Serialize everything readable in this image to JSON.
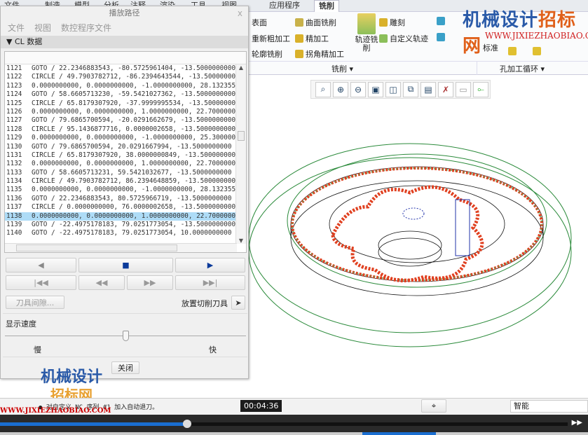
{
  "ribbon": {
    "tabs": [
      "文件",
      "制造",
      "模型",
      "分析",
      "注释",
      "渲染",
      "工具",
      "视图",
      "应用程序",
      "铣削"
    ],
    "active_tab": "铣削",
    "items": {
      "surface": "表面",
      "rerough": "重新粗加工",
      "profile": "轮廓铣削",
      "surface_mill": "曲面铣削",
      "finish": "精加工",
      "corner_finish": "拐角精加工",
      "trajectory": "轨迹铣削",
      "engrave": "雕刻",
      "custom_traj": "自定义轨迹",
      "standard": "标准"
    },
    "groups": {
      "milling": "铣削 ▾",
      "hole": "孔加工循环 ▾"
    }
  },
  "dialog": {
    "title": "播放路径",
    "close": "x",
    "menu": [
      "文件",
      "视图",
      "数控程序文件"
    ],
    "section": "CL 数据",
    "rows": [
      [
        "1121",
        "GOTO / 22.2346883543, -80.5725961404, -13.5000000000"
      ],
      [
        "1122",
        "CIRCLE / 49.7903782712, -86.2394643544, -13.5000000000"
      ],
      [
        "1123",
        "0.0000000000, 0.0000000000, -1.0000000000,  28.132355"
      ],
      [
        "1124",
        "GOTO / 58.6605713230, -59.5421027362, -13.5000000000"
      ],
      [
        "1125",
        "CIRCLE / 65.8179307920, -37.9999995534, -13.5000000000"
      ],
      [
        "1126",
        "0.0000000000, 0.0000000000, 1.0000000000,  22.7000000"
      ],
      [
        "1127",
        "GOTO / 79.6865700594, -20.0291662679, -13.5000000000"
      ],
      [
        "1128",
        "CIRCLE / 95.1436877716, 0.0000002658, -13.5000000000,"
      ],
      [
        "1129",
        "0.0000000000, 0.0000000000, -1.0000000000,  25.300000"
      ],
      [
        "1130",
        "GOTO / 79.6865700594, 20.0291667994, -13.5000000000"
      ],
      [
        "1131",
        "CIRCLE / 65.8179307920, 38.0000000849, -13.5000000000"
      ],
      [
        "1132",
        "0.0000000000, 0.0000000000, 1.0000000000,  22.7000000"
      ],
      [
        "1133",
        "GOTO / 58.6605713231, 59.5421032677, -13.5000000000"
      ],
      [
        "1134",
        "CIRCLE / 49.7903782712, 86.2394648859, -13.5000000000"
      ],
      [
        "1135",
        "0.0000000000, 0.0000000000, -1.0000000000,  28.132355"
      ],
      [
        "1136",
        "GOTO / 22.2346883543, 80.5725966719, -13.5000000000"
      ],
      [
        "1137",
        "CIRCLE / 0.0000000000, 76.0000002658, -13.5000000000,"
      ],
      [
        "1138",
        "0.0000000000, 0.0000000000, 1.0000000000,  22.7000000"
      ],
      [
        "1139",
        "GOTO / -22.4975178183, 79.0251773054, -13.5000000000"
      ],
      [
        "1140",
        "GOTO / -22.4975178183, 79.0251773054, 10.0000000000"
      ]
    ],
    "selected_row": "1138",
    "tool_clearance": "刀具间隙...",
    "place_tool": "放置切削刀具",
    "speed_label": "显示速度",
    "slow": "慢",
    "fast": "快",
    "speed_value": 0.5,
    "close_button": "关闭"
  },
  "status": {
    "message": "● 对自定义 NC 序列 #1 加入自动退刀。",
    "filter": "智能"
  },
  "video": {
    "time": "00:04:36",
    "progress": 0.33
  },
  "watermark": {
    "cn1": "机械设计",
    "cn2": "招标网",
    "url": "WWW.JIXIEZHAOBIAO.COM"
  }
}
